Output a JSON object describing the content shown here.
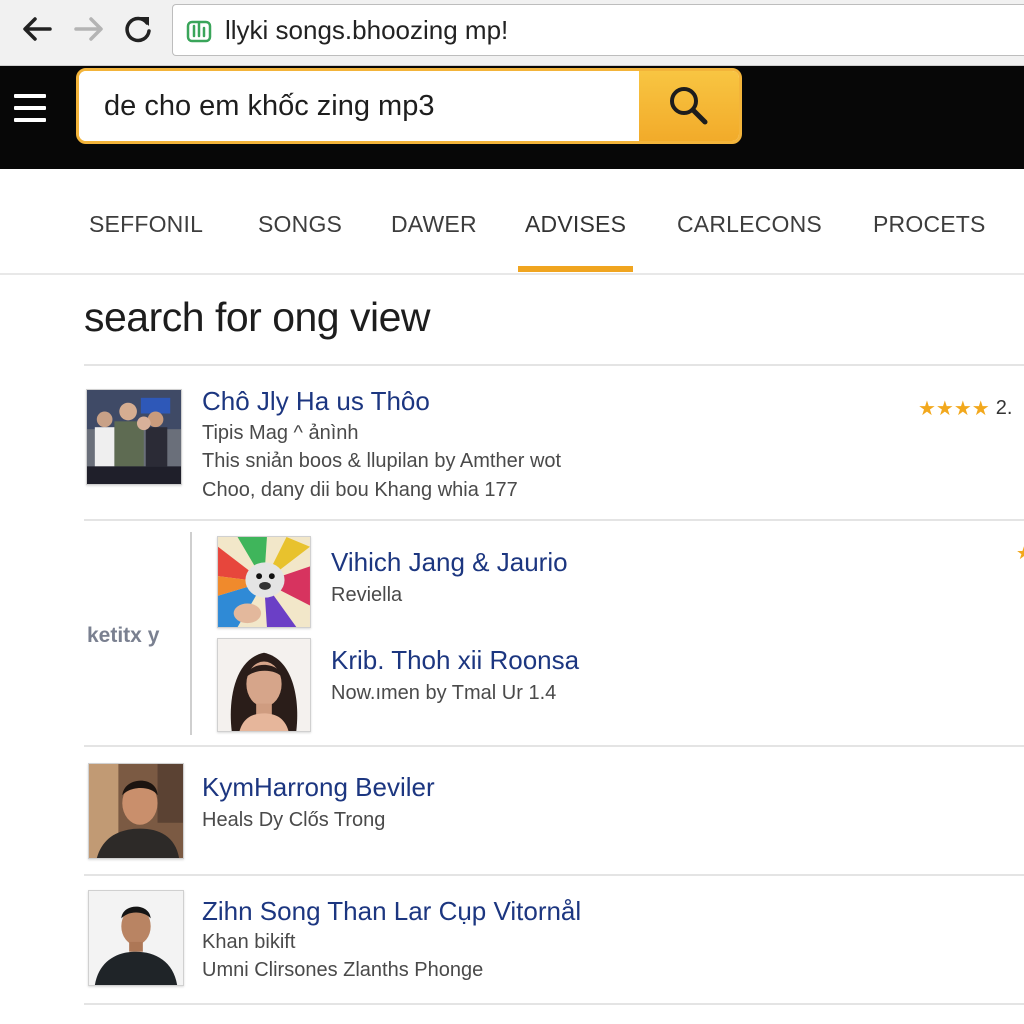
{
  "browser": {
    "url": "llyki songs.bhoozing mp!"
  },
  "header": {
    "search_value": "de cho em khốc zing mp3",
    "search_placeholder": "Search"
  },
  "tabs": [
    {
      "label": "SEFFONIL"
    },
    {
      "label": "SONGS"
    },
    {
      "label": "DAWER"
    },
    {
      "label": "ADVISES",
      "active": true
    },
    {
      "label": "CARLECONS"
    },
    {
      "label": "PROCETS"
    }
  ],
  "page_title": "search for ong view",
  "results": [
    {
      "title": "Chô Jly Ha us Thôo",
      "lines": [
        "Tipis Mag ^ ảnình",
        "This sniản boos & llupilan by Amther wot",
        "Choo, dany dii bou Khang whia 177"
      ],
      "rating_stars": "★★★★",
      "rating_value": "2."
    },
    {
      "title": "Vihich Jang & Jaurio",
      "lines": [
        "Reviella"
      ],
      "rating_stars": "★"
    },
    {
      "title": "Krib. Thoh xii Roonsa",
      "lines": [
        "Now.ımen by Tmal Ur 1.4"
      ]
    },
    {
      "title": "KymHarrong Beviler",
      "lines": [
        "Heals Dy Clős Trong"
      ]
    },
    {
      "title": "Zihn Song Than Lar Cụp Vitornål",
      "lines": [
        "Khan bikift",
        "Umni Clirsones Zlanths Phonge"
      ]
    }
  ],
  "side_label": "ketitx y",
  "colors": {
    "accent": "#f0a520",
    "header_bg": "#070707",
    "link": "#1c3680"
  },
  "icons": {
    "back": "arrow-left",
    "forward": "arrow-right",
    "reload": "reload",
    "secure": "secure-page",
    "menu": "hamburger",
    "search": "magnifier"
  }
}
